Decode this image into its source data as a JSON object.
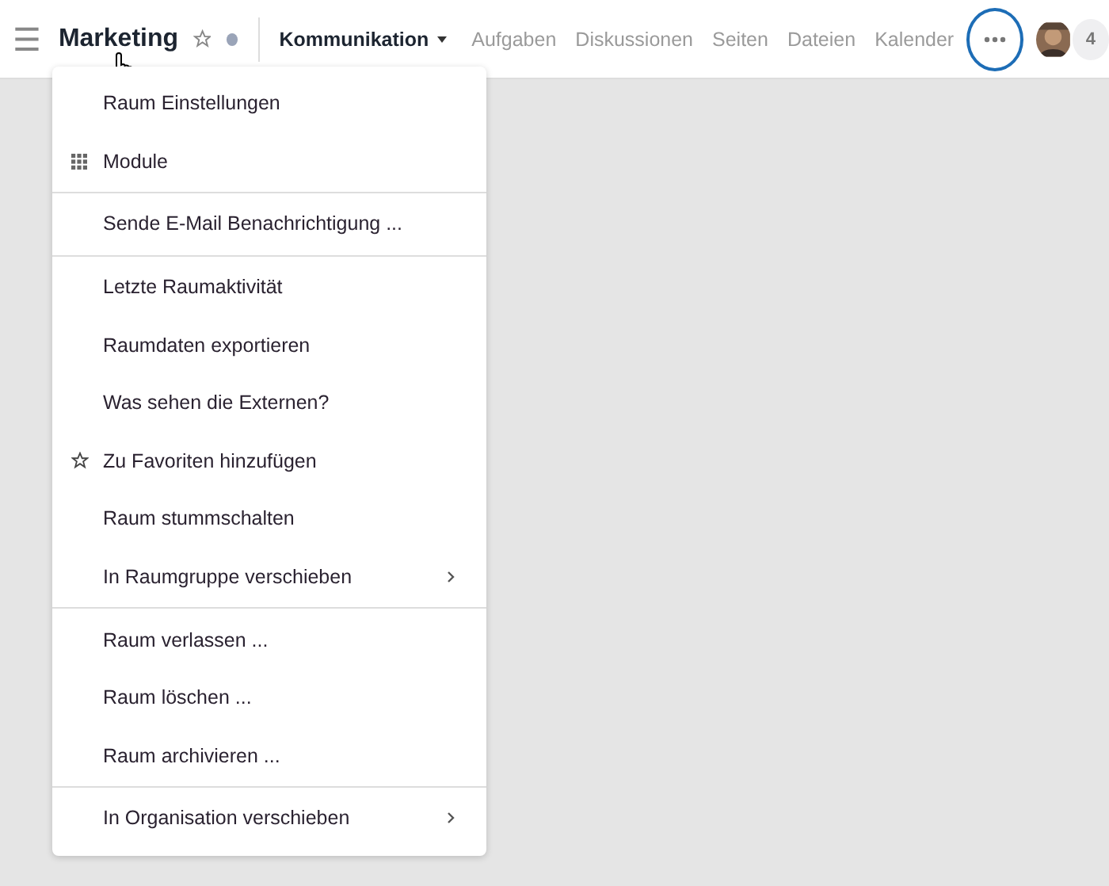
{
  "header": {
    "menu_icon": "☰",
    "title": "Marketing",
    "favorite": false,
    "tabs": [
      {
        "label": "Kommunikation",
        "selected": true,
        "dropdown": true
      },
      {
        "label": "Aufgaben",
        "selected": false,
        "dropdown": false
      },
      {
        "label": "Diskussionen",
        "selected": false,
        "dropdown": false
      },
      {
        "label": "Seiten",
        "selected": false,
        "dropdown": false
      },
      {
        "label": "Dateien",
        "selected": false,
        "dropdown": false
      },
      {
        "label": "Kalender",
        "selected": false,
        "dropdown": false
      }
    ],
    "more_highlighted": true,
    "member_count": "4"
  },
  "menu": {
    "sections": [
      [
        {
          "label": "Raum Einstellungen",
          "kind": "plain",
          "submenu": false
        },
        {
          "label": "Module",
          "kind": "grid",
          "submenu": false
        }
      ],
      [
        {
          "label": "Sende E-Mail Benachrichtigung ...",
          "kind": "plain",
          "submenu": false
        }
      ],
      [
        {
          "label": "Letzte Raumaktivität",
          "kind": "plain",
          "submenu": false
        },
        {
          "label": "Raumdaten exportieren",
          "kind": "plain",
          "submenu": false
        },
        {
          "label": "Was sehen die Externen?",
          "kind": "plain",
          "submenu": false
        },
        {
          "label": "Zu Favoriten hinzufügen",
          "kind": "star",
          "submenu": false
        },
        {
          "label": "Raum stummschalten",
          "kind": "plain",
          "submenu": false
        },
        {
          "label": "In Raumgruppe verschieben",
          "kind": "plain",
          "submenu": true
        }
      ],
      [
        {
          "label": "Raum verlassen ...",
          "kind": "plain",
          "submenu": false
        },
        {
          "label": "Raum löschen ...",
          "kind": "plain",
          "submenu": false
        },
        {
          "label": "Raum archivieren ...",
          "kind": "plain",
          "submenu": false
        }
      ],
      [
        {
          "label": "In Organisation verschieben",
          "kind": "plain",
          "submenu": true
        }
      ]
    ]
  }
}
